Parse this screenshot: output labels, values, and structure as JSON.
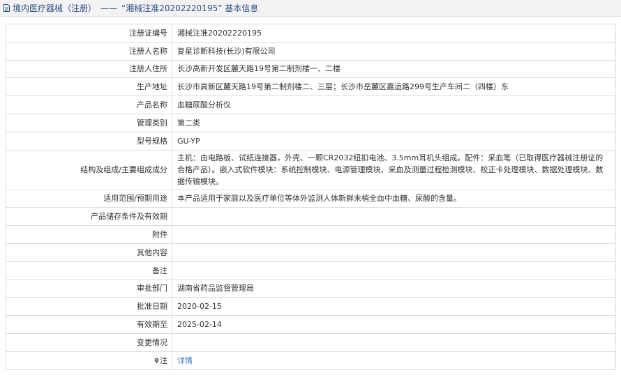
{
  "header": {
    "section": "境内医疗器械（注册）",
    "separator": "——",
    "title": "“湘械注准20202220195” 基本信息"
  },
  "rows": [
    {
      "label": "注册证编号",
      "value": "湘械注准20202220195"
    },
    {
      "label": "注册人名称",
      "value": "复星诊断科技(长沙)有限公司"
    },
    {
      "label": "注册人住所",
      "value": "长沙高新开发区麓天路19号第二制剂楼一、二楼"
    },
    {
      "label": "生产地址",
      "value": "长沙市高新区麓天路19号第二制剂楼二、三层；长沙市岳麓区嘉运路299号生产车间二（四楼）东"
    },
    {
      "label": "产品名称",
      "value": "血糖尿酸分析仪"
    },
    {
      "label": "管理类别",
      "value": "第二类"
    },
    {
      "label": "型号规格",
      "value": "GU-YP"
    },
    {
      "label": "结构及组成/主要组成成分",
      "value": "主机：由电路板、试纸连接器，外壳、一颗CR2032纽扣电池、3.5mm耳机头组成。配件：采血笔（已取得医疗器械注册证的合格产品）。嵌入式软件模块：系统控制模块、电源管理模块、采血及测量过程检测模块、校正卡处理模块、数据处理模块、数据传输模块。"
    },
    {
      "label": "适用范围/预期用途",
      "value": "本产品适用于家庭以及医疗单位等体外监测人体新鲜末梢全血中血糖、尿酸的含量。"
    },
    {
      "label": "产品储存条件及有效期",
      "value": ""
    },
    {
      "label": "附件",
      "value": ""
    },
    {
      "label": "其他内容",
      "value": ""
    },
    {
      "label": "备注",
      "value": ""
    },
    {
      "label": "审批部门",
      "value": "湖南省药品监督管理局"
    },
    {
      "label": "批准日期",
      "value": "2020-02-15"
    },
    {
      "label": "有效期至",
      "value": "2025-02-14"
    },
    {
      "label": "变更情况",
      "value": ""
    }
  ],
  "note": {
    "label": "注",
    "link": "详情"
  }
}
